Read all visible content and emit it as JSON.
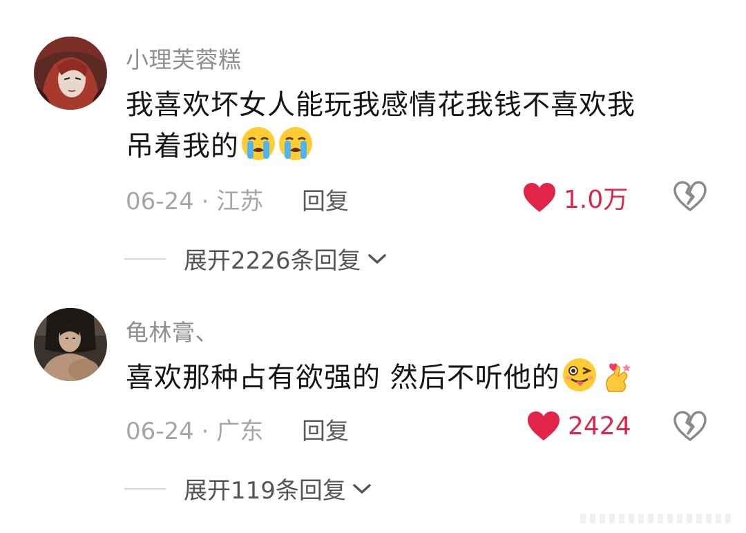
{
  "colors": {
    "like_red": "#e0244a",
    "meta_gray": "#a6a6a6",
    "username_gray": "#8e8e93"
  },
  "comments": [
    {
      "username": "小理芙蓉糕",
      "text_line1": "我喜欢坏女人能玩我感情花我钱不喜欢我",
      "text_line2": "吊着我的",
      "emojis": [
        "loudly-crying-face-icon",
        "loudly-crying-face-icon"
      ],
      "date_location": "06-24 · 江苏",
      "reply_label": "回复",
      "like_count": "1.0万",
      "expand_label": "展开2226条回复"
    },
    {
      "username": "龟林膏、",
      "text_line1": "喜欢那种占有欲强的 然后不听他的",
      "emojis": [
        "winking-tongue-face-icon",
        "finger-heart-icon"
      ],
      "date_location": "06-24 · 广东",
      "reply_label": "回复",
      "like_count": "2424",
      "expand_label": "展开119条回复"
    }
  ]
}
